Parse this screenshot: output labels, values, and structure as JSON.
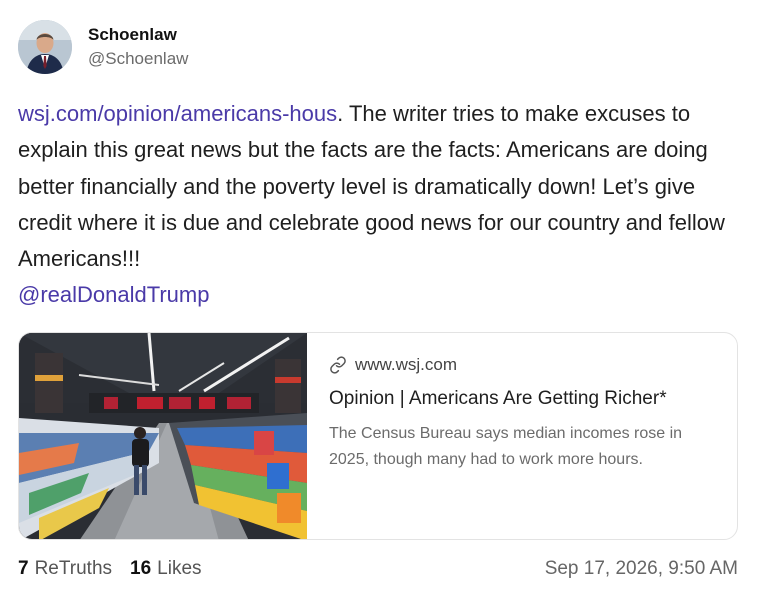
{
  "author": {
    "display_name": "Schoenlaw",
    "handle": "@Schoenlaw"
  },
  "post": {
    "link_text": "wsj.com/opinion/americans-hous",
    "text": ".  The writer tries to make excuses to explain this great news but the facts are the facts: Americans are doing better financially and the poverty level is dramatically down!  Let’s give credit where it is due and celebrate good news for our country and fellow Americans!!!",
    "mention": "@realDonaldTrump"
  },
  "card": {
    "domain": "www.wsj.com",
    "title": "Opinion | Americans Are Getting Richer*",
    "description": "The Census Bureau says median incomes rose in 2025, though many had to work more hours."
  },
  "stats": {
    "retruths_count": "7",
    "retruths_label": "ReTruths",
    "likes_count": "16",
    "likes_label": "Likes"
  },
  "timestamp": "Sep 17, 2026, 9:50 AM",
  "colors": {
    "link": "#4a3aa8",
    "text": "#1f1f1f",
    "muted": "#6b6b6b"
  },
  "icons": {
    "card_link": "link-icon"
  }
}
